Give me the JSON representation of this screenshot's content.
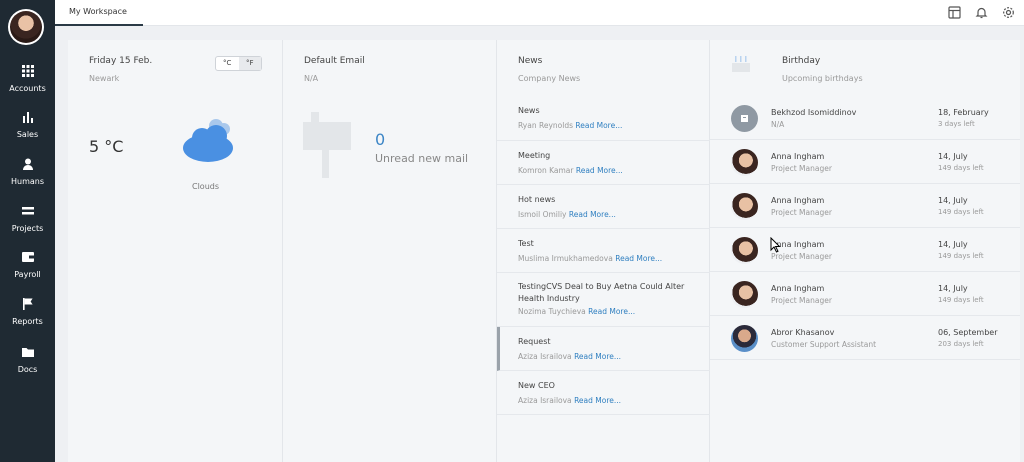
{
  "sidebar": {
    "items": [
      {
        "label": "Accounts",
        "icon": "grid-icon"
      },
      {
        "label": "Sales",
        "icon": "bar-chart-icon"
      },
      {
        "label": "Humans",
        "icon": "person-icon"
      },
      {
        "label": "Projects",
        "icon": "stack-icon"
      },
      {
        "label": "Payroll",
        "icon": "wallet-icon"
      },
      {
        "label": "Reports",
        "icon": "flag-icon"
      },
      {
        "label": "Docs",
        "icon": "folder-icon"
      }
    ]
  },
  "topbar": {
    "tab_label": "My Workspace",
    "icons": [
      "layout-icon",
      "bell-icon",
      "gear-icon"
    ]
  },
  "weather": {
    "date": "Friday 15 Feb.",
    "city": "Newark",
    "unit_c": "°C",
    "unit_f": "°F",
    "temperature": "5 °C",
    "condition": "Clouds",
    "cloud_color": "#4a90e2"
  },
  "email": {
    "title": "Default Email",
    "address": "N/A",
    "count": "0",
    "unread_label": "Unread new mail"
  },
  "news": {
    "title": "News",
    "subtitle": "Company News",
    "read_more": "Read More...",
    "items": [
      {
        "title": "News",
        "author": "Ryan Reynolds"
      },
      {
        "title": "Meeting",
        "author": "Komron Kamar"
      },
      {
        "title": "Hot news",
        "author": "Ismoil Omiliy"
      },
      {
        "title": "Test",
        "author": "Muslima Irmukhamedova"
      },
      {
        "title": "TestingCVS Deal to Buy Aetna Could Alter Health Industry",
        "author": "Nozima Tuychieva"
      },
      {
        "title": "Request",
        "author": "Aziza Israilova"
      },
      {
        "title": "New CEO",
        "author": "Aziza Israilova"
      }
    ]
  },
  "birthday": {
    "title": "Birthday",
    "subtitle": "Upcoming birthdays",
    "items": [
      {
        "name": "Bekhzod Isomiddinov",
        "role": "N/A",
        "date": "18, February",
        "left": "3 days left"
      },
      {
        "name": "Anna Ingham",
        "role": "Project Manager",
        "date": "14, July",
        "left": "149 days left"
      },
      {
        "name": "Anna Ingham",
        "role": "Project Manager",
        "date": "14, July",
        "left": "149 days left"
      },
      {
        "name": "Anna Ingham",
        "role": "Project Manager",
        "date": "14, July",
        "left": "149 days left"
      },
      {
        "name": "Anna Ingham",
        "role": "Project Manager",
        "date": "14, July",
        "left": "149 days left"
      },
      {
        "name": "Abror Khasanov",
        "role": "Customer Support Assistant",
        "date": "06, September",
        "left": "203 days left"
      }
    ]
  },
  "colors": {
    "sidebar_bg": "#1f2a33",
    "accent": "#2f7fc0"
  }
}
